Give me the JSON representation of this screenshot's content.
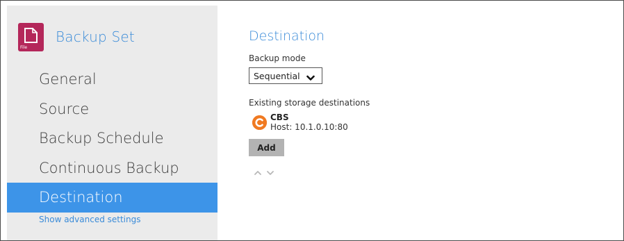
{
  "header": {
    "title": "Backup Set",
    "icon": "file-icon",
    "icon_tag": "File",
    "icon_color": "#b4275a"
  },
  "sidebar": {
    "items": [
      {
        "label": "General"
      },
      {
        "label": "Source"
      },
      {
        "label": "Backup Schedule"
      },
      {
        "label": "Continuous Backup"
      },
      {
        "label": "Destination",
        "active": true
      }
    ],
    "advanced_link": "Show advanced settings"
  },
  "main": {
    "section_title": "Destination",
    "backup_mode_label": "Backup mode",
    "backup_mode_value": "Sequential",
    "existing_label": "Existing storage destinations",
    "destination": {
      "name": "CBS",
      "host": "Host: 10.1.0.10:80",
      "icon": "cbs-icon",
      "icon_color": "#f07a22"
    },
    "add_label": "Add"
  },
  "colors": {
    "accent": "#3a8bd8",
    "active_nav": "#3d94e8",
    "sidebar_bg": "#ebebeb"
  }
}
